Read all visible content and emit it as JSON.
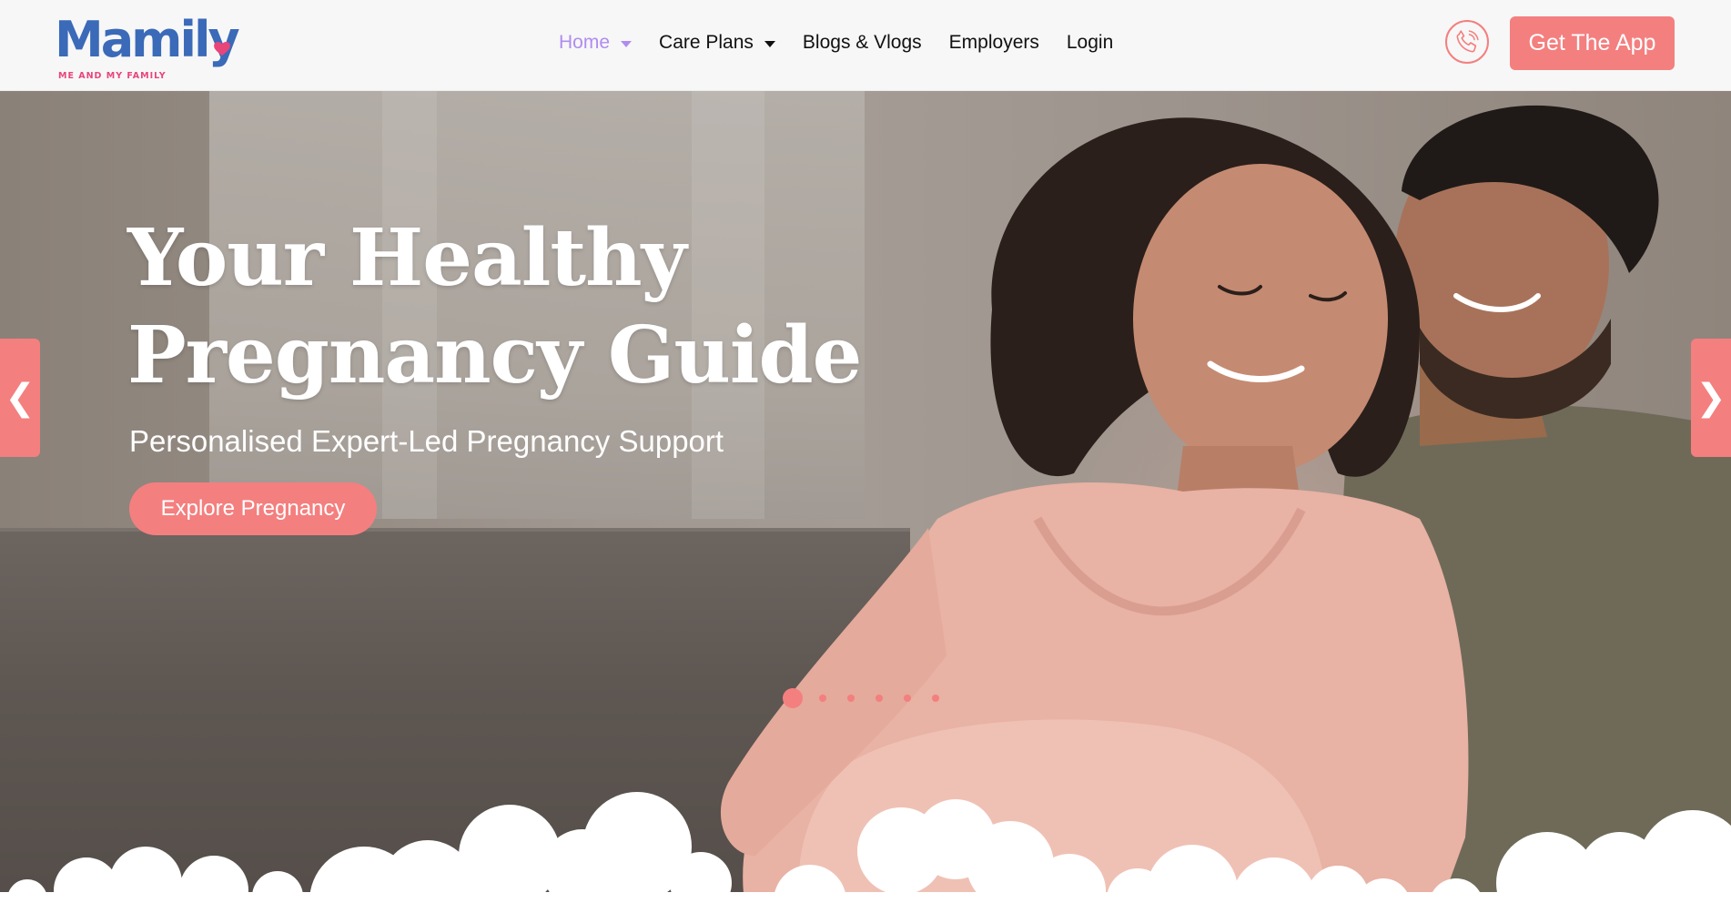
{
  "brand": {
    "name": "Mamily",
    "tagline": "ME AND MY FAMILY",
    "colors": {
      "logo_blue": "#3a6ab8",
      "heart_pink": "#e8457a",
      "accent_coral": "#f47f7f",
      "active_nav": "#b08cf0"
    }
  },
  "nav": {
    "items": [
      {
        "label": "Home",
        "active": true,
        "dropdown": true
      },
      {
        "label": "Care Plans",
        "active": false,
        "dropdown": true
      },
      {
        "label": "Blogs & Vlogs",
        "active": false,
        "dropdown": false
      },
      {
        "label": "Employers",
        "active": false,
        "dropdown": false
      },
      {
        "label": "Login",
        "active": false,
        "dropdown": false
      }
    ],
    "phone_icon": "phone-icon",
    "cta_label": "Get The App"
  },
  "hero": {
    "title_line1": "Your Healthy",
    "title_line2": "Pregnancy Guide",
    "subtitle": "Personalised Expert-Led Pregnancy Support",
    "cta_label": "Explore Pregnancy",
    "prev_glyph": "❮",
    "next_glyph": "❯",
    "image_description_icon": "couple-photo",
    "carousel": {
      "total_slides": 6,
      "active_index": 0
    }
  }
}
